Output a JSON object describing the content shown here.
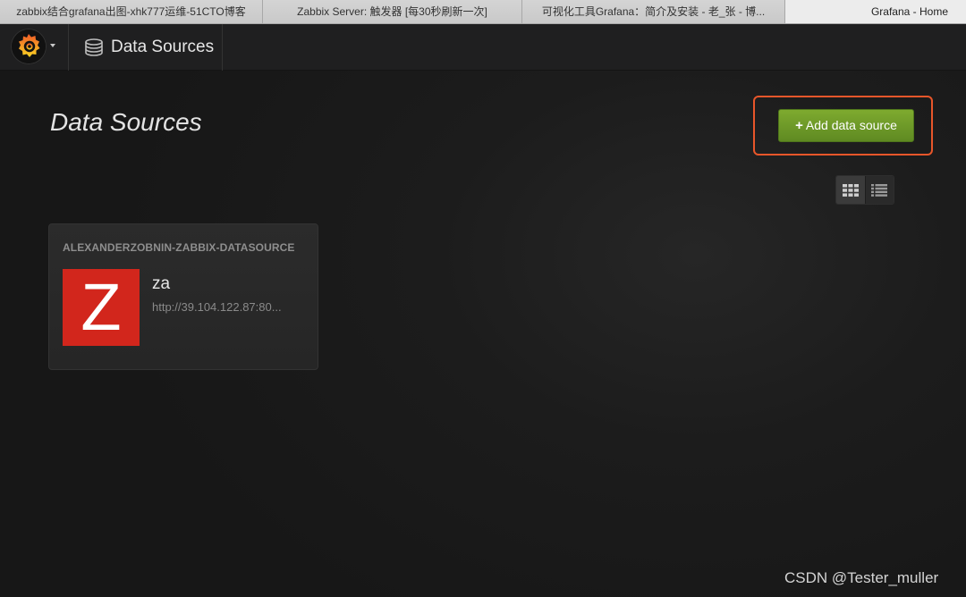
{
  "browser": {
    "tabs": [
      {
        "title": "zabbix结合grafana出图-xhk777运维-51CTO博客"
      },
      {
        "title": "Zabbix Server: 触发器 [每30秒刷新一次]"
      },
      {
        "title": "可视化工具Grafana：简介及安装 - 老_张 - 博..."
      },
      {
        "title": "Grafana - Home"
      }
    ]
  },
  "navbar": {
    "logo_icon": "grafana-logo-icon",
    "section_icon": "database-icon",
    "section_title": "Data Sources"
  },
  "page": {
    "title": "Data Sources",
    "add_button_label": "Add data source",
    "add_button_icon": "plus-icon",
    "highlight_color": "#e8562a",
    "accent_green": "#6e9b28"
  },
  "view_toggle": {
    "options": [
      {
        "name": "grid",
        "icon": "grid-icon",
        "active": true
      },
      {
        "name": "list",
        "icon": "list-icon",
        "active": false
      }
    ]
  },
  "datasources": [
    {
      "type": "ALEXANDERZOBNIN-ZABBIX-DATASOURCE",
      "logo_letter": "Z",
      "logo_color": "#d2261c",
      "name": "za",
      "url": "http://39.104.122.87:80..."
    }
  ],
  "watermark": "CSDN @Tester_muller"
}
